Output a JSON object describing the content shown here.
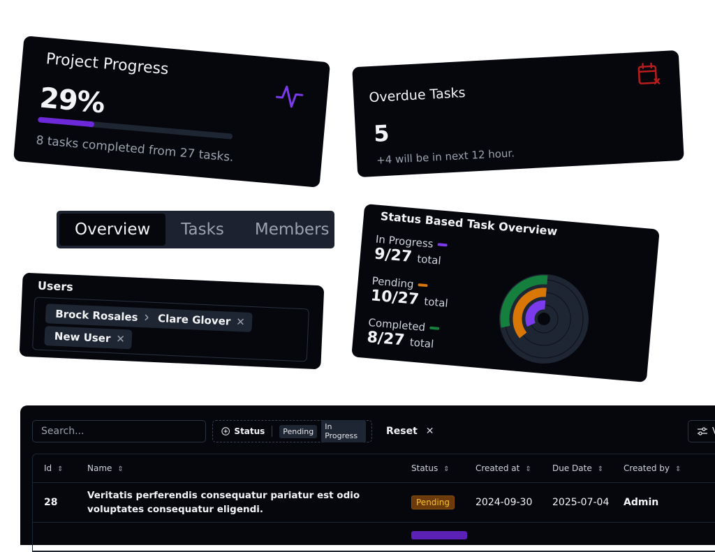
{
  "project_progress": {
    "title": "Project Progress",
    "percent_label": "29%",
    "progress_fraction": 0.29,
    "subtitle": "8 tasks completed from 27 tasks.",
    "icon": "activity-pulse-icon",
    "accent": "#7c3aed"
  },
  "overdue": {
    "title": "Overdue Tasks",
    "count": "5",
    "subtitle": "+4 will be in next 12 hour.",
    "icon": "calendar-x-icon",
    "accent": "#b91c1c"
  },
  "tabs": [
    {
      "label": "Overview",
      "active": true
    },
    {
      "label": "Tasks",
      "active": false
    },
    {
      "label": "Members",
      "active": false
    }
  ],
  "users": {
    "label": "Users",
    "chips": [
      "Brock Rosales",
      "Clare Glover",
      "New User"
    ]
  },
  "status_overview": {
    "title": "Status Based Task Overview",
    "items": [
      {
        "label": "In Progress",
        "value": "9/27",
        "suffix": "total",
        "color": "#7c3aed",
        "fraction": 0.333
      },
      {
        "label": "Pending",
        "value": "10/27",
        "suffix": "total",
        "color": "#d97706",
        "fraction": 0.37
      },
      {
        "label": "Completed",
        "value": "8/27",
        "suffix": "total",
        "color": "#15803d",
        "fraction": 0.296
      }
    ]
  },
  "toolbar": {
    "search_placeholder": "Search...",
    "status_filter_label": "Status",
    "status_filter_values": [
      "Pending",
      "In Progress"
    ],
    "reset_label": "Reset",
    "view_label": "V"
  },
  "table": {
    "headers": [
      "Id",
      "Name",
      "Status",
      "Created at",
      "Due Date",
      "Created by"
    ],
    "rows": [
      {
        "id": "28",
        "name": "Veritatis perferendis consequatur pariatur est odio voluptates consequatur eligendi.",
        "status": "Pending",
        "created_at": "2024-09-30",
        "due_date": "2025-07-04",
        "created_by": "Admin"
      }
    ]
  }
}
